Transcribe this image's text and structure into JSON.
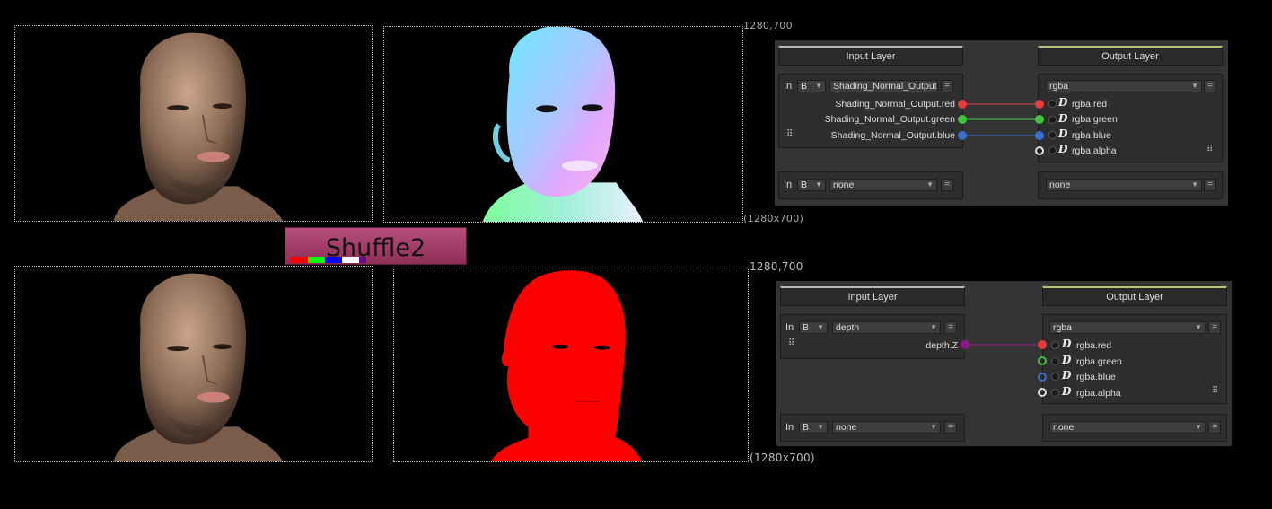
{
  "top": {
    "viewer_right_label_top": "1280,700",
    "viewer_right_label_bottom": "(1280x700)",
    "panel": {
      "input_header": "Input Layer",
      "output_header": "Output Layer",
      "in1": {
        "in_label": "In",
        "b_option": "B",
        "layer": "Shading_Normal_Output",
        "eq": "="
      },
      "out1": {
        "layer": "rgba",
        "eq": "="
      },
      "input_channels": [
        "Shading_Normal_Output.red",
        "Shading_Normal_Output.green",
        "Shading_Normal_Output.blue"
      ],
      "output_channels": [
        "rgba.red",
        "rgba.green",
        "rgba.blue",
        "rgba.alpha"
      ],
      "in2": {
        "in_label": "In",
        "b_option": "B",
        "layer": "none",
        "eq": "="
      },
      "out2": {
        "layer": "none",
        "eq": "="
      }
    }
  },
  "node": {
    "title": "Shuffle2",
    "swatch_colors": [
      "#ff0000",
      "#00ff00",
      "#0000ff",
      "#ffffff",
      "#6a0a8a"
    ]
  },
  "bottom": {
    "viewer_right_label_top": "1280,700",
    "viewer_right_label_bottom": "(1280x700)",
    "panel": {
      "input_header": "Input Layer",
      "output_header": "Output Layer",
      "in1": {
        "in_label": "In",
        "b_option": "B",
        "layer": "depth",
        "eq": "="
      },
      "out1": {
        "layer": "rgba",
        "eq": "="
      },
      "input_channels": [
        "depth.Z"
      ],
      "output_channels": [
        "rgba.red",
        "rgba.green",
        "rgba.blue",
        "rgba.alpha"
      ],
      "in2": {
        "in_label": "In",
        "b_option": "B",
        "layer": "none",
        "eq": "="
      },
      "out2": {
        "layer": "none",
        "eq": "="
      }
    }
  },
  "colors": {
    "red": "#e83a3a",
    "green": "#3ec43e",
    "blue": "#3a6fd0",
    "purple": "#8a1a8a",
    "white": "#dddddd"
  },
  "icons": {
    "grip": "grip-icon",
    "dropdown": "chevron-down-icon",
    "d_glyph": "d-channel-icon"
  }
}
